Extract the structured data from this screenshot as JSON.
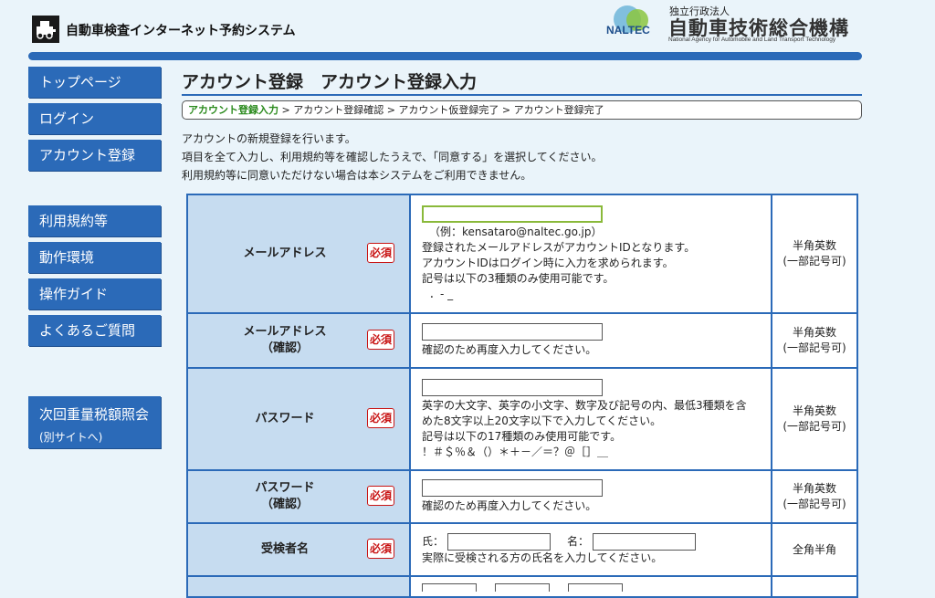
{
  "header": {
    "site_title": "自動車検査インターネット予約システム",
    "org_small": "独立行政法人",
    "org_name": "自動車技術総合機構",
    "org_en": "National Agency for Automobile and Land Transport Technology",
    "logo_text": "NALTEC"
  },
  "sidebar": {
    "items": [
      {
        "label": "トップページ"
      },
      {
        "label": "ログイン"
      },
      {
        "label": "アカウント登録"
      },
      {
        "label": "利用規約等"
      },
      {
        "label": "動作環境"
      },
      {
        "label": "操作ガイド"
      },
      {
        "label": "よくあるご質問"
      },
      {
        "label": "次回重量税額照会",
        "sub": "(別サイトへ)"
      }
    ]
  },
  "main": {
    "title": "アカウント登録　アカウント登録入力",
    "steps": {
      "current": "アカウント登録入力",
      "rest": " > アカウント登録確認 > アカウント仮登録完了 > アカウント登録完了"
    },
    "intro": [
      "アカウントの新規登録を行います。",
      "項目を全て入力し、利用規約等を確認したうえで、「同意する」を選択してください。",
      "利用規約等に同意いただけない場合は本システムをご利用できません。"
    ],
    "required_label": "必須",
    "rows": {
      "email": {
        "label": "メールアドレス",
        "value": "",
        "notes": [
          "（例：kensataro@naltec.go.jp）",
          "登録されたメールアドレスがアカウントIDとなります。",
          "アカウントIDはログイン時に入力を求められます。",
          "記号は以下の3種類のみ使用可能です。",
          "．- _"
        ],
        "type_1": "半角英数",
        "type_2": "(一部記号可)"
      },
      "email_confirm": {
        "label_1": "メールアドレス",
        "label_2": "（確認）",
        "value": "",
        "note": "確認のため再度入力してください。",
        "type_1": "半角英数",
        "type_2": "(一部記号可)"
      },
      "password": {
        "label": "パスワード",
        "value": "",
        "notes": [
          "英字の大文字、英字の小文字、数字及び記号の内、最低3種類を含",
          "めた8文字以上20文字以下で入力してください。",
          "記号は以下の17種類のみ使用可能です。",
          "！＃＄％＆（）＊＋－／＝？＠［］＿"
        ],
        "type_1": "半角英数",
        "type_2": "(一部記号可)"
      },
      "password_confirm": {
        "label_1": "パスワード",
        "label_2": "（確認）",
        "value": "",
        "note": "確認のため再度入力してください。",
        "type_1": "半角英数",
        "type_2": "(一部記号可)"
      },
      "name": {
        "label": "受検者名",
        "last_label": "氏：",
        "first_label": "名：",
        "last_value": "",
        "first_value": "",
        "note": "実際に受検される方の氏名を入力してください。",
        "type": "全角半角"
      }
    }
  },
  "colors": {
    "accent": "#2b6ab8",
    "label_bg": "#c6dcf0",
    "required": "#c81414",
    "current_step": "#2a8a1c",
    "page_bg": "#eaf4fa"
  }
}
